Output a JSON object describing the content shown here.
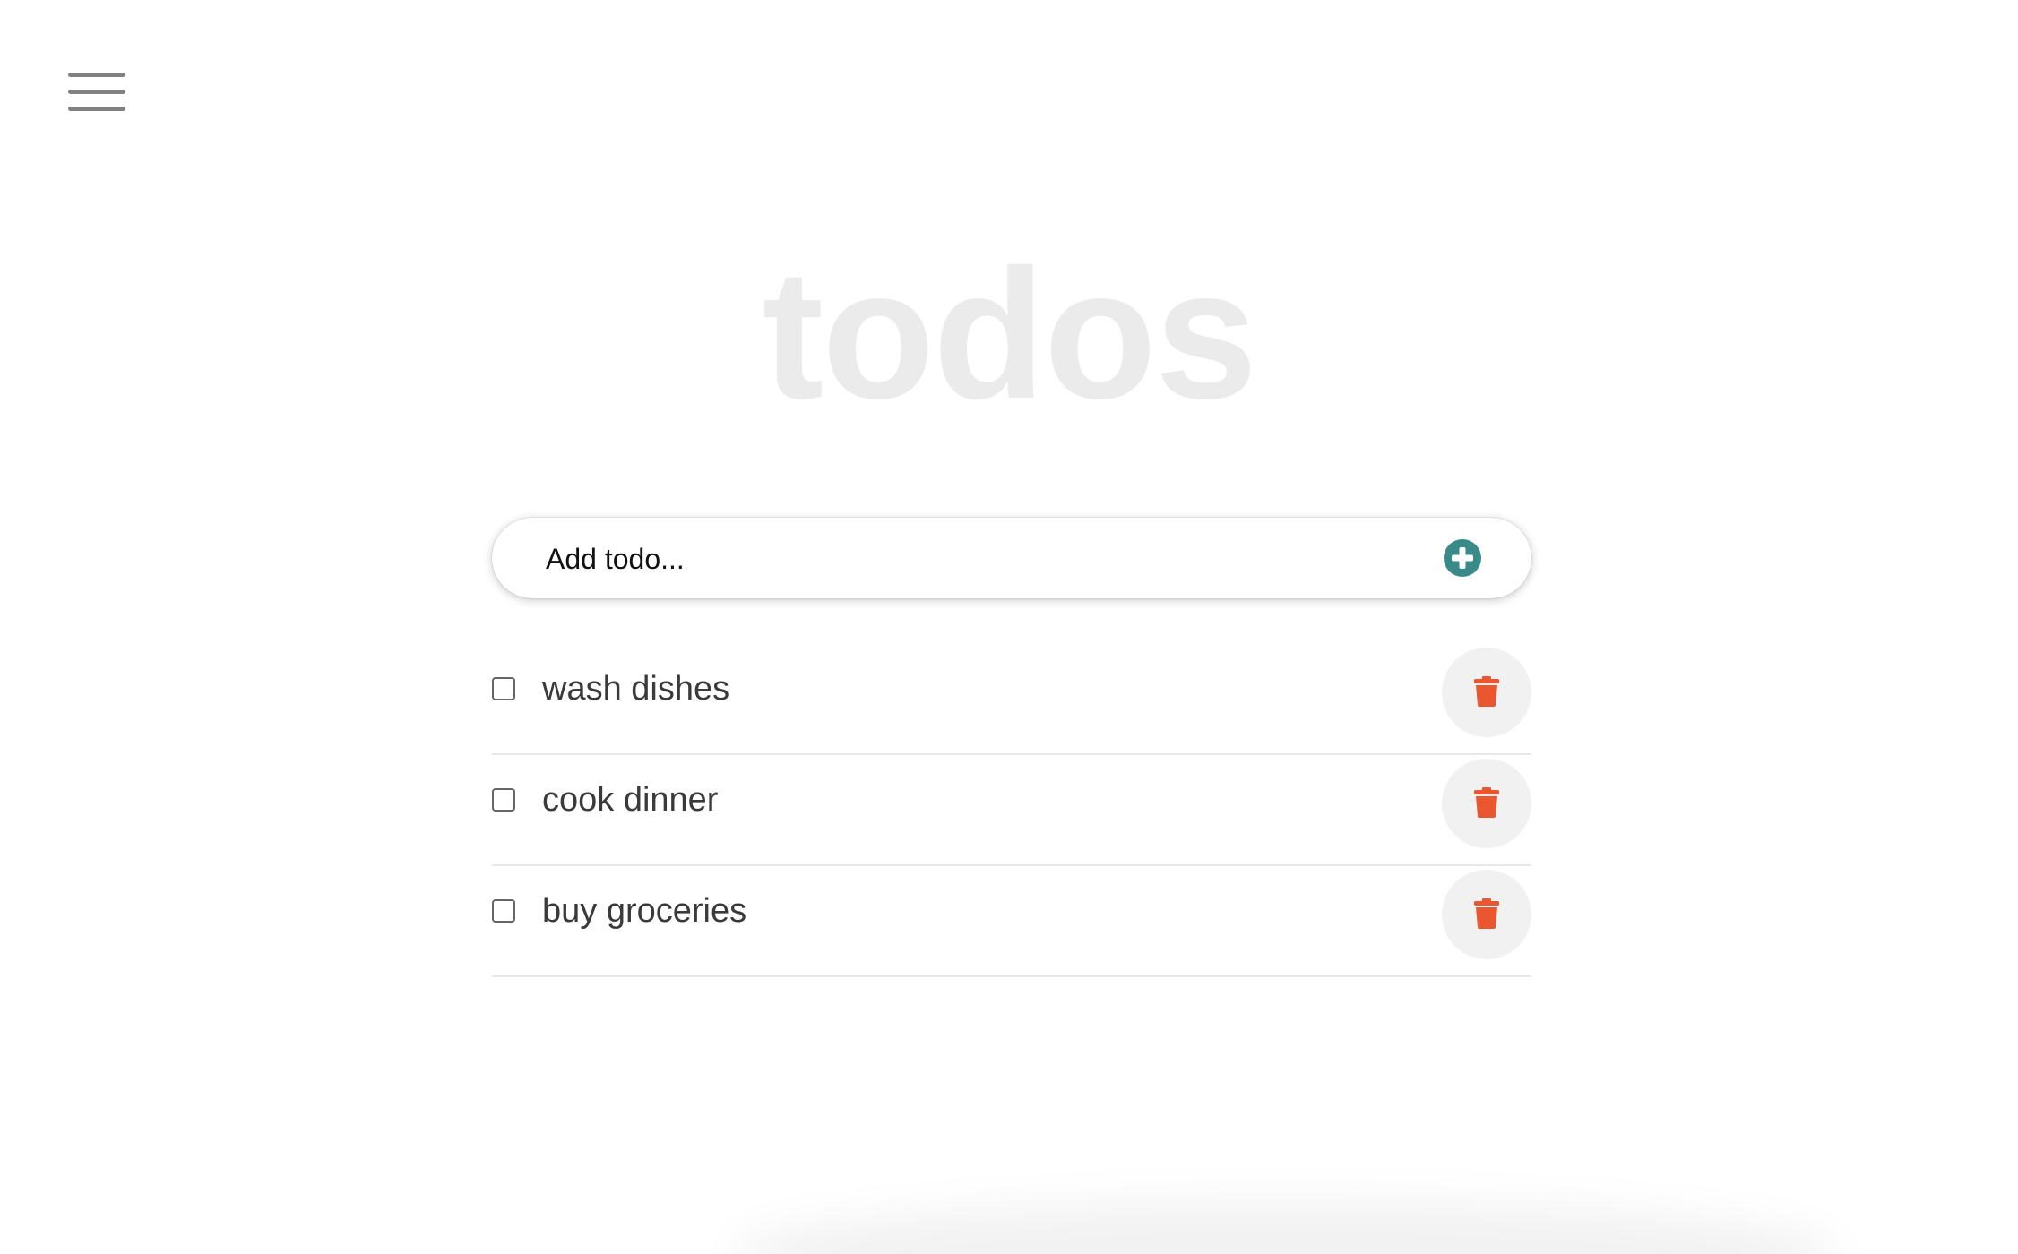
{
  "app": {
    "title": "todos"
  },
  "menu": {
    "icon": "hamburger-menu-icon"
  },
  "add_todo": {
    "placeholder": "Add todo...",
    "value": "",
    "button_icon": "plus-circle-icon",
    "button_color": "#3a8a89"
  },
  "todos": [
    {
      "text": "wash dishes",
      "done": false
    },
    {
      "text": "cook dinner",
      "done": false
    },
    {
      "text": "buy groceries",
      "done": false
    }
  ],
  "delete_icon": "trash-icon",
  "colors": {
    "title": "#ebebeb",
    "delete_icon": "#e9562f",
    "delete_button_bg": "#f1f1f1",
    "text": "#3a3a3a"
  }
}
